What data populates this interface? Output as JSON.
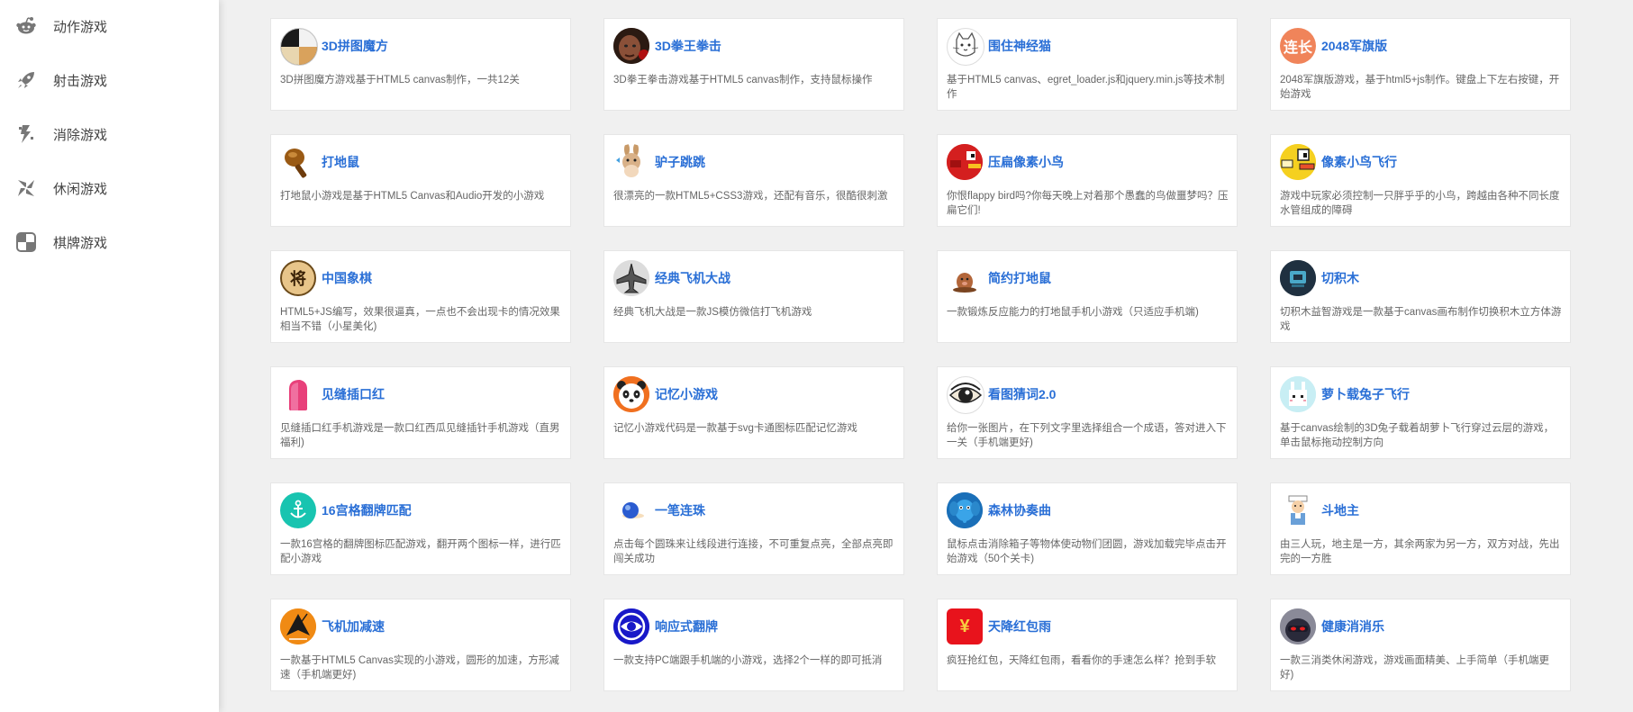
{
  "sidebar": {
    "items": [
      {
        "label": "动作游戏",
        "icon": "reddit-alien-icon"
      },
      {
        "label": "射击游戏",
        "icon": "rocket-icon"
      },
      {
        "label": "消除游戏",
        "icon": "lightning-icon"
      },
      {
        "label": "休闲游戏",
        "icon": "pinwheel-icon"
      },
      {
        "label": "棋牌游戏",
        "icon": "board-grid-icon"
      }
    ]
  },
  "games": [
    {
      "title": "3D拼图魔方",
      "desc": "3D拼图魔方游戏基于HTML5 canvas制作，一共12关",
      "icon": "cube-puzzle-icon"
    },
    {
      "title": "3D拳王拳击",
      "desc": "3D拳王拳击游戏基于HTML5 canvas制作，支持鼠标操作",
      "icon": "boxer-face-icon"
    },
    {
      "title": "围住神经猫",
      "desc": "基于HTML5 canvas、egret_loader.js和jquery.min.js等技术制作",
      "icon": "cat-icon"
    },
    {
      "title": "2048军旗版",
      "desc": "2048军旗版游戏，基于html5+js制作。键盘上下左右按键，开始游戏",
      "icon": "lianzhang-badge-icon",
      "badge": "连长"
    },
    {
      "title": "打地鼠",
      "desc": "打地鼠小游戏是基于HTML5 Canvas和Audio开发的小游戏",
      "icon": "mallet-icon"
    },
    {
      "title": "驴子跳跳",
      "desc": "很漂亮的一款HTML5+CSS3游戏，还配有音乐，很酷很刺激",
      "icon": "donkey-icon"
    },
    {
      "title": "压扁像素小鸟",
      "desc": "你恨flappy bird吗?你每天晚上对着那个愚蠢的鸟做噩梦吗？压扁它们!",
      "icon": "red-bird-icon"
    },
    {
      "title": "像素小鸟飞行",
      "desc": "游戏中玩家必须控制一只胖乎乎的小鸟，跨越由各种不同长度水管组成的障碍",
      "icon": "yellow-bird-icon"
    },
    {
      "title": "中国象棋",
      "desc": "HTML5+JS编写，效果很逼真，一点也不会出现卡的情况效果相当不错（小星美化)",
      "icon": "chess-piece-icon",
      "badge": "将"
    },
    {
      "title": "经典飞机大战",
      "desc": "经典飞机大战是一款JS模仿微信打飞机游戏",
      "icon": "plane-icon"
    },
    {
      "title": "简约打地鼠",
      "desc": "一款锻炼反应能力的打地鼠手机小游戏（只适应手机端)",
      "icon": "mole-icon"
    },
    {
      "title": "切积木",
      "desc": "切积木益智游戏是一款基于canvas画布制作切换积木立方体游戏",
      "icon": "block-icon"
    },
    {
      "title": "见缝插口红",
      "desc": "见缝插口红手机游戏是一款口红西瓜见缝插针手机游戏（直男福利)",
      "icon": "lipstick-icon"
    },
    {
      "title": "记忆小游戏",
      "desc": "记忆小游戏代码是一款基于svg卡通图标匹配记忆游戏",
      "icon": "panda-icon"
    },
    {
      "title": "看图猜词2.0",
      "desc": "给你一张图片，在下列文字里选择组合一个成语，答对进入下一关（手机端更好)",
      "icon": "eye-icon"
    },
    {
      "title": "萝卜载兔子飞行",
      "desc": "基于canvas绘制的3D兔子载着胡萝卜飞行穿过云层的游戏，单击鼠标拖动控制方向",
      "icon": "rabbit-icon"
    },
    {
      "title": "16宫格翻牌匹配",
      "desc": "一款16宫格的翻牌图标匹配游戏，翻开两个图标一样，进行匹配小游戏",
      "icon": "anchor-icon"
    },
    {
      "title": "一笔连珠",
      "desc": "点击每个圆珠来让线段进行连接，不可重复点亮，全部点亮即闯关成功",
      "icon": "blue-ball-icon"
    },
    {
      "title": "森林协奏曲",
      "desc": "鼠标点击消除箱子等物体使动物们团圆，游戏加载完毕点击开始游戏（50个关卡)",
      "icon": "elephant-icon"
    },
    {
      "title": "斗地主",
      "desc": "由三人玩，地主是一方，其余两家为另一方，双方对战，先出完的一方胜",
      "icon": "farmer-icon"
    },
    {
      "title": "飞机加减速",
      "desc": "一款基于HTML5 Canvas实现的小游戏，圆形的加速，方形减速（手机端更好)",
      "icon": "jet-icon"
    },
    {
      "title": "响应式翻牌",
      "desc": "一款支持PC端跟手机端的小游戏，选择2个一样的即可抵消",
      "icon": "eye-ring-icon"
    },
    {
      "title": "天降红包雨",
      "desc": "疯狂抢红包，天降红包雨，看看你的手速怎么样？抢到手软",
      "icon": "red-envelope-icon",
      "badge": "¥"
    },
    {
      "title": "健康消消乐",
      "desc": "一款三消类休闲游戏，游戏画面精美、上手简单（手机端更好)",
      "icon": "ninja-icon"
    }
  ]
}
